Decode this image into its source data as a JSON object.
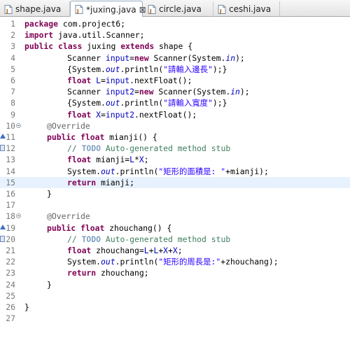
{
  "tabs": [
    {
      "label": "shape.java",
      "active": false
    },
    {
      "label": "*juxing.java",
      "active": true,
      "close": "⊠"
    },
    {
      "label": "circle.java",
      "active": false
    },
    {
      "label": "ceshi.java",
      "active": false
    }
  ],
  "editor": {
    "lines": [
      {
        "n": "1",
        "text": "package com.project6;"
      },
      {
        "n": "2",
        "text": "import java.util.Scanner;"
      },
      {
        "n": "3",
        "text": "public class juxing extends shape {"
      },
      {
        "n": "4",
        "text": "Scanner input=new Scanner(System.in);"
      },
      {
        "n": "5",
        "text": "{System.out.println(\"請輸入邊長\");}"
      },
      {
        "n": "6",
        "text": "float L=input.nextFloat();"
      },
      {
        "n": "7",
        "text": "Scanner input2=new Scanner(System.in);"
      },
      {
        "n": "8",
        "text": "{System.out.println(\"請輸入寬度\");}"
      },
      {
        "n": "9",
        "text": "float X=input2.nextFloat();"
      },
      {
        "n": "10",
        "text": "@Override"
      },
      {
        "n": "11",
        "text": "public float mianji() {"
      },
      {
        "n": "12",
        "text": "// TODO Auto-generated method stub"
      },
      {
        "n": "13",
        "text": "float mianji=L*X;"
      },
      {
        "n": "14",
        "text": "System.out.println(\"矩形的面積是: \"+mianji);"
      },
      {
        "n": "15",
        "text": "return mianji;"
      },
      {
        "n": "16",
        "text": "}"
      },
      {
        "n": "17",
        "text": ""
      },
      {
        "n": "18",
        "text": "@Override"
      },
      {
        "n": "19",
        "text": "public float zhouchang() {"
      },
      {
        "n": "20",
        "text": "// TODO Auto-generated method stub"
      },
      {
        "n": "21",
        "text": "float zhouchang=L+L+X+X;"
      },
      {
        "n": "22",
        "text": "System.out.println(\"矩形的周長是:\"+zhouchang);"
      },
      {
        "n": "23",
        "text": "return zhouchang;"
      },
      {
        "n": "24",
        "text": "}"
      },
      {
        "n": "25",
        "text": ""
      },
      {
        "n": "26",
        "text": "}"
      },
      {
        "n": "27",
        "text": ""
      }
    ],
    "current_line": 15
  },
  "icons": {
    "file_icon": "java-file-icon",
    "fold_icon": "collapse-icon",
    "override_marker": "override-arrow-icon",
    "task_marker": "task-icon"
  },
  "colors": {
    "keyword": "#7f0055",
    "field": "#0000c0",
    "string": "#2a00ff",
    "comment": "#3f7f5f",
    "annotation": "#646464",
    "current_line": "#e8f2fe"
  }
}
